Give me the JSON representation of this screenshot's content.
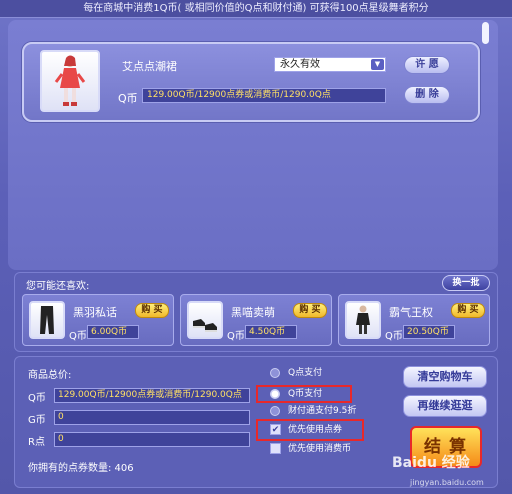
{
  "notice": "每在商城中消费1Q币( 或相同价值的Q点和财付通) 可获得100点星级舞者积分",
  "cart_item": {
    "name": "艾点点潮裙",
    "duration": "永久有效",
    "price_label": "Q币",
    "price": "129.00Q币/12900点券或消费币/1290.0Q点",
    "wish_label": "许 愿",
    "delete_label": "删 除"
  },
  "recommendations": {
    "title": "您可能还喜欢:",
    "swap_label": "换一批",
    "items": [
      {
        "name": "黑羽私话",
        "currency": "Q币",
        "price": "6.00Q币",
        "buy_label": "购 买"
      },
      {
        "name": "黑喵卖萌",
        "currency": "Q币",
        "price": "4.50Q币",
        "buy_label": "购 买"
      },
      {
        "name": "霸气王权",
        "currency": "Q币",
        "price": "20.50Q币",
        "buy_label": "购 买"
      }
    ]
  },
  "totals": {
    "title": "商品总价:",
    "rows": [
      {
        "label": "Q币",
        "value": "129.00Q币/12900点券或消费币/1290.0Q点"
      },
      {
        "label": "G币",
        "value": "0"
      },
      {
        "label": "R点",
        "value": "0"
      }
    ],
    "owned": "你拥有的点券数量: 406"
  },
  "payment": {
    "options": [
      {
        "label": "Q点支付",
        "selected": false
      },
      {
        "label": "Q币支付",
        "selected": true
      },
      {
        "label": "财付通支付9.5折",
        "selected": false
      }
    ],
    "checks": [
      {
        "label": "优先使用点券",
        "checked": true
      },
      {
        "label": "优先使用消费币",
        "checked": false
      }
    ]
  },
  "actions": {
    "clear_cart": "清空购物车",
    "continue_shopping": "再继续逛逛",
    "checkout": "结算"
  },
  "watermark": {
    "text": "Baidu 经验",
    "sub": "jingyan.baidu.com"
  }
}
